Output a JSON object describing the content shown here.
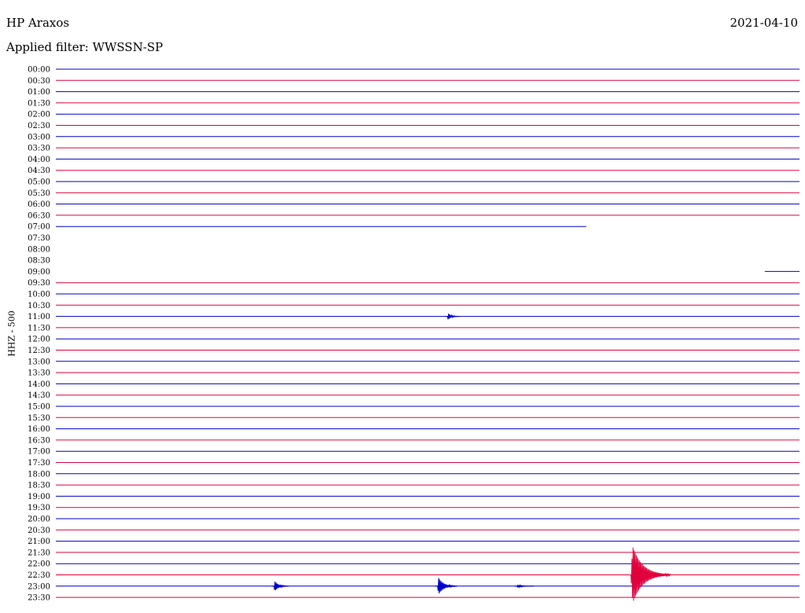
{
  "header": {
    "station": "HP Araxos",
    "date": "2021-04-10",
    "filter": "Applied filter: WWSSN-SP"
  },
  "chart_data": {
    "type": "line",
    "title": "HP Araxos",
    "ylabel": "HHZ - 500",
    "x_unit": "minutes within 30-minute row",
    "row_labels": [
      "00:00",
      "00:30",
      "01:00",
      "01:30",
      "02:00",
      "02:30",
      "03:00",
      "03:30",
      "04:00",
      "04:30",
      "05:00",
      "05:30",
      "06:00",
      "06:30",
      "07:00",
      "07:30",
      "08:00",
      "08:30",
      "09:00",
      "09:30",
      "10:00",
      "10:30",
      "11:00",
      "11:30",
      "12:00",
      "12:30",
      "13:00",
      "13:30",
      "14:00",
      "14:30",
      "15:00",
      "15:30",
      "16:00",
      "16:30",
      "17:00",
      "17:30",
      "18:00",
      "18:30",
      "19:00",
      "19:30",
      "20:00",
      "20:30",
      "21:00",
      "21:30",
      "22:00",
      "22:30",
      "23:00",
      "23:30"
    ],
    "row_colors": [
      "#0000cc",
      "#e0003c"
    ],
    "trace_extent": {
      "07:00": [
        0,
        21.4
      ],
      "07:30": null,
      "08:00": null,
      "08:30": null,
      "09:00": [
        28.6,
        30
      ]
    },
    "events": [
      {
        "row": "11:00",
        "minute": 15.8,
        "amplitude": 0.35,
        "duration": 0.3
      },
      {
        "row": "23:00",
        "minute": 8.8,
        "amplitude": 0.55,
        "duration": 0.4
      },
      {
        "row": "23:00",
        "minute": 15.4,
        "amplitude": 0.9,
        "duration": 0.6
      },
      {
        "row": "23:00",
        "minute": 18.6,
        "amplitude": 0.15,
        "duration": 0.5
      },
      {
        "row": "22:30",
        "minute": 23.2,
        "amplitude": 3.0,
        "duration": 1.4
      }
    ],
    "grid": false
  }
}
